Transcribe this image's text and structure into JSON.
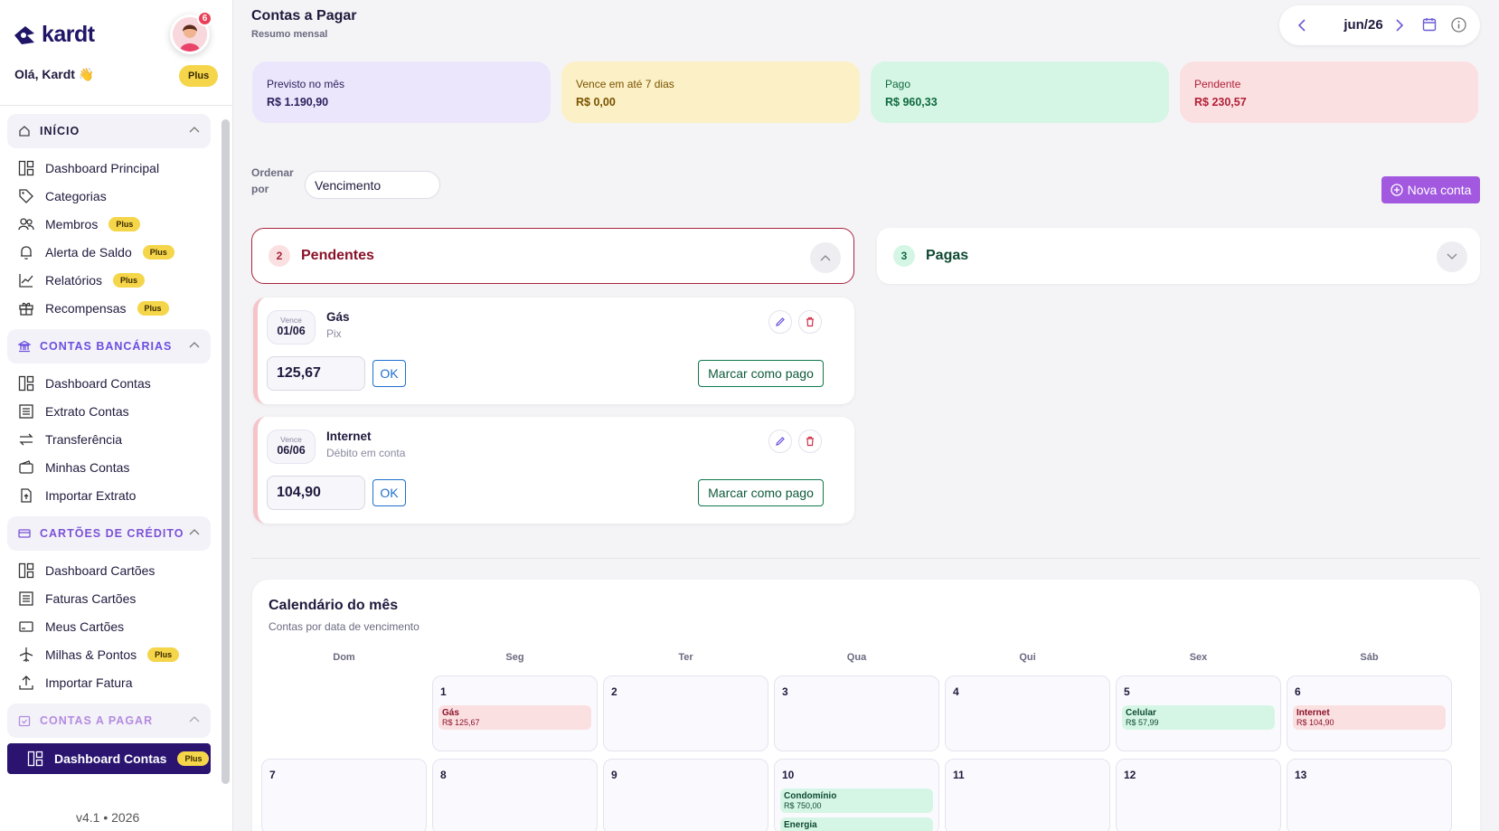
{
  "app": {
    "brand": "kardt",
    "notifications": "6",
    "greeting": "Olá, Kardt 👋",
    "plan": "Plus",
    "version": "v4.1 • 2026"
  },
  "sidebar": {
    "sections": [
      {
        "title": "INÍCIO",
        "items": [
          {
            "label": "Dashboard Principal",
            "badge": ""
          },
          {
            "label": "Categorias",
            "badge": ""
          },
          {
            "label": "Membros",
            "badge": "Plus"
          },
          {
            "label": "Alerta de Saldo",
            "badge": "Plus"
          },
          {
            "label": "Relatórios",
            "badge": "Plus"
          },
          {
            "label": "Recompensas",
            "badge": "Plus"
          }
        ]
      },
      {
        "title": "CONTAS BANCÁRIAS",
        "items": [
          {
            "label": "Dashboard Contas",
            "badge": ""
          },
          {
            "label": "Extrato Contas",
            "badge": ""
          },
          {
            "label": "Transferência",
            "badge": ""
          },
          {
            "label": "Minhas Contas",
            "badge": ""
          },
          {
            "label": "Importar Extrato",
            "badge": ""
          }
        ]
      },
      {
        "title": "CARTÕES DE CRÉDITO",
        "items": [
          {
            "label": "Dashboard Cartões",
            "badge": ""
          },
          {
            "label": "Faturas Cartões",
            "badge": ""
          },
          {
            "label": "Meus Cartões",
            "badge": ""
          },
          {
            "label": "Milhas & Pontos",
            "badge": "Plus"
          },
          {
            "label": "Importar Fatura",
            "badge": ""
          }
        ]
      },
      {
        "title": "CONTAS A PAGAR",
        "items": [
          {
            "label": "Dashboard Contas",
            "badge": "Plus"
          }
        ]
      }
    ]
  },
  "header": {
    "title": "Contas a Pagar",
    "subtitle": "Resumo mensal",
    "month": "jun/26"
  },
  "stats": [
    {
      "label": "Previsto no mês",
      "value": "R$ 1.190,90"
    },
    {
      "label": "Vence em até 7 dias",
      "value": "R$ 0,00"
    },
    {
      "label": "Pago",
      "value": "R$ 960,33"
    },
    {
      "label": "Pendente",
      "value": "R$ 230,57"
    }
  ],
  "toolbar": {
    "order_label": "Ordenar por",
    "order_value": "Vencimento",
    "new_label": "Nova conta"
  },
  "pending": {
    "count": "2",
    "title": "Pendentes"
  },
  "paid": {
    "count": "3",
    "title": "Pagas"
  },
  "bills": [
    {
      "due_label": "Vence",
      "due_date": "01/06",
      "name": "Gás",
      "method": "Pix",
      "amount": "125,67",
      "ok": "OK",
      "pay": "Marcar como pago"
    },
    {
      "due_label": "Vence",
      "due_date": "06/06",
      "name": "Internet",
      "method": "Débito em conta",
      "amount": "104,90",
      "ok": "OK",
      "pay": "Marcar como pago"
    }
  ],
  "calendar": {
    "title": "Calendário do mês",
    "subtitle": "Contas por data de vencimento",
    "weekdays": [
      "Dom",
      "Seg",
      "Ter",
      "Qua",
      "Qui",
      "Sex",
      "Sáb"
    ],
    "days": [
      "1",
      "2",
      "3",
      "4",
      "5",
      "6",
      "7",
      "8",
      "9",
      "10",
      "11",
      "12",
      "13"
    ],
    "events": [
      {
        "name": "Gás",
        "amount": "R$ 125,67",
        "status": "pending"
      },
      {
        "name": "Celular",
        "amount": "R$ 57,99",
        "status": "paid"
      },
      {
        "name": "Internet",
        "amount": "R$ 104,90",
        "status": "pending"
      },
      {
        "name": "Condomínio",
        "amount": "R$ 750,00",
        "status": "paid"
      },
      {
        "name": "Energia",
        "amount": "",
        "status": "paid"
      }
    ]
  }
}
